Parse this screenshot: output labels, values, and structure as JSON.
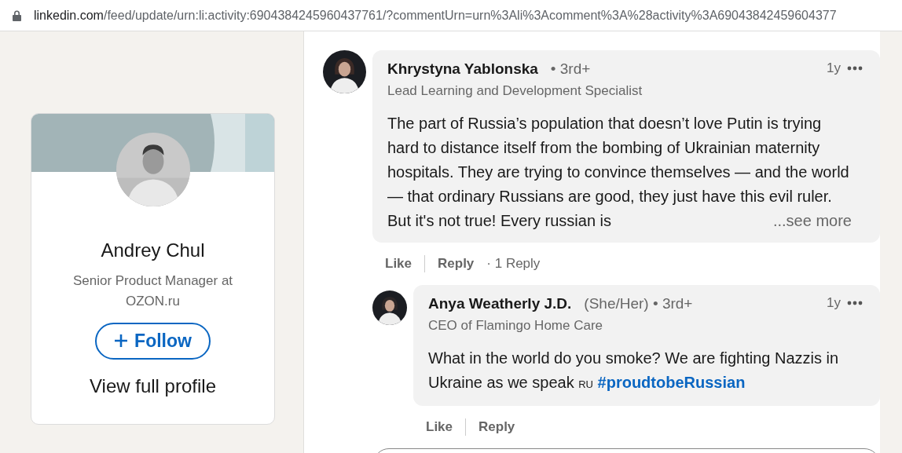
{
  "address_bar": {
    "host": "linkedin.com",
    "path": "/feed/update/urn:li:activity:6904384245960437761/?commentUrn=urn%3Ali%3Acomment%3A%28activity%3A69043842459604377"
  },
  "profile_card": {
    "name": "Andrey Chul",
    "headline": "Senior Product Manager at OZON.ru",
    "follow_button": "Follow",
    "view_profile": "View full profile"
  },
  "comments": [
    {
      "author": "Khrystyna Yablonska",
      "degree": "• 3rd+",
      "headline": "Lead Learning and Development Specialist",
      "time": "1y",
      "text": [
        {
          "kind": "text",
          "text": "The part of Russia’s population that doesn’t love Putin is trying hard to distance itself from the bombing of Ukrainian maternity hospitals. They are trying to convince themselves — and the world — that ordinary Russians are good, they just have this evil ruler. But it's not true! Every russian is"
        }
      ],
      "see_more": "...see more",
      "actions": [
        "Like",
        "Reply"
      ],
      "reply_count": "· 1 Reply",
      "replies": [
        {
          "author": "Anya Weatherly J.D.",
          "pronouns": "(She/Her)",
          "degree": "• 3rd+",
          "headline": "CEO of Flamingo Home Care",
          "time": "1y",
          "text": [
            {
              "kind": "text",
              "text": "What in the world do you smoke? We are fighting Nazzis in Ukraine as we speak"
            },
            {
              "kind": "flag",
              "text": "RU"
            },
            {
              "kind": "hashtag",
              "text": "#proudtobeRussian"
            }
          ],
          "actions": [
            "Like",
            "Reply"
          ]
        }
      ]
    }
  ]
}
